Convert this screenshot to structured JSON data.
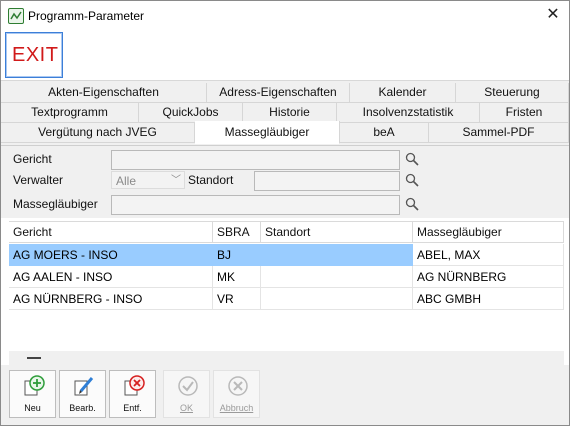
{
  "window": {
    "title": "Programm-Parameter"
  },
  "toolbar": {
    "exit_label": "EXIT"
  },
  "tabs": {
    "row1": [
      "Akten-Eigenschaften",
      "Adress-Eigenschaften",
      "Kalender",
      "Steuerung"
    ],
    "row2": [
      "Textprogramm",
      "QuickJobs",
      "Historie",
      "Insolvenzstatistik",
      "Fristen"
    ],
    "row3": [
      "Vergütung nach JVEG",
      "Massegläubiger",
      "beA",
      "Sammel-PDF"
    ],
    "active": "Massegläubiger"
  },
  "filter": {
    "gericht_label": "Gericht",
    "gericht_value": "",
    "verwalter_label": "Verwalter",
    "verwalter_value": "Alle",
    "standort_label": "Standort",
    "standort_value": "",
    "massegl_label": "Massegläubiger",
    "massegl_value": ""
  },
  "table": {
    "headers": [
      "Gericht",
      "SBRA",
      "Standort",
      "Massegläubiger"
    ],
    "rows": [
      [
        "AG MOERS - INSO",
        "BJ",
        "",
        "ABEL, MAX"
      ],
      [
        "AG AALEN - INSO",
        "MK",
        "",
        "AG NÜRNBERG"
      ],
      [
        "AG NÜRNBERG - INSO",
        "VR",
        "",
        "ABC GMBH"
      ]
    ],
    "selected_row": 0
  },
  "status": {
    "dash": "—"
  },
  "actions": {
    "new_label": "Neu",
    "edit_label": "Bearb.",
    "delete_label": "Entf.",
    "ok_label": "OK",
    "cancel_label": "Abbruch"
  },
  "colors": {
    "selection": "#99ccff",
    "exit_red": "#d11a1a",
    "accent_blue": "#3c7fd8",
    "new_green": "#2e9d3a",
    "delete_red": "#d62020"
  }
}
